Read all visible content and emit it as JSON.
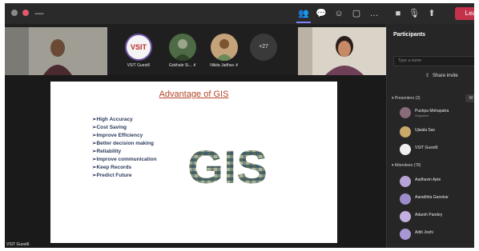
{
  "meeting": {
    "presenter_label": "VSIT Guest6"
  },
  "video_strip": {
    "tiles": [
      {
        "label": "VSIT Guest6"
      },
      {
        "label": "Gokhale Si..."
      },
      {
        "label": "Nikita Jadhav"
      },
      {
        "label": "+27"
      }
    ],
    "logo_text": "VSIT"
  },
  "slide": {
    "title": "Advantage of GIS",
    "bullets": [
      "➢High Accuracy",
      "➢Cost Saving",
      "➢Improve Efficiency",
      "➢Better decision making",
      "➢Reliability",
      "➢Improve communication",
      "➢Keep Records",
      "➢Predict Future"
    ],
    "art_text": "GIS"
  },
  "panel": {
    "title": "Participants",
    "search_placeholder": "Type a name",
    "share_invite": "Share invite",
    "presenters_header": "Presenters (3)",
    "attendees_header": "Attendees (78)",
    "presenters": [
      {
        "name": "Pushpa Mohapatra",
        "role": "Organizer"
      },
      {
        "name": "Ujwala Sav",
        "role": ""
      },
      {
        "name": "VSIT Guest6",
        "role": ""
      }
    ],
    "attendees": [
      {
        "name": "Aadhavin Apte"
      },
      {
        "name": "Aaradhita Ganekar"
      },
      {
        "name": "Adarsh Pandey"
      },
      {
        "name": "Aditi Joshi"
      }
    ]
  },
  "colors": {
    "accent": "#7f85f5",
    "leave": "#c4314b",
    "slide_title": "#b5452a",
    "bullet_text": "#2b3a5c"
  }
}
